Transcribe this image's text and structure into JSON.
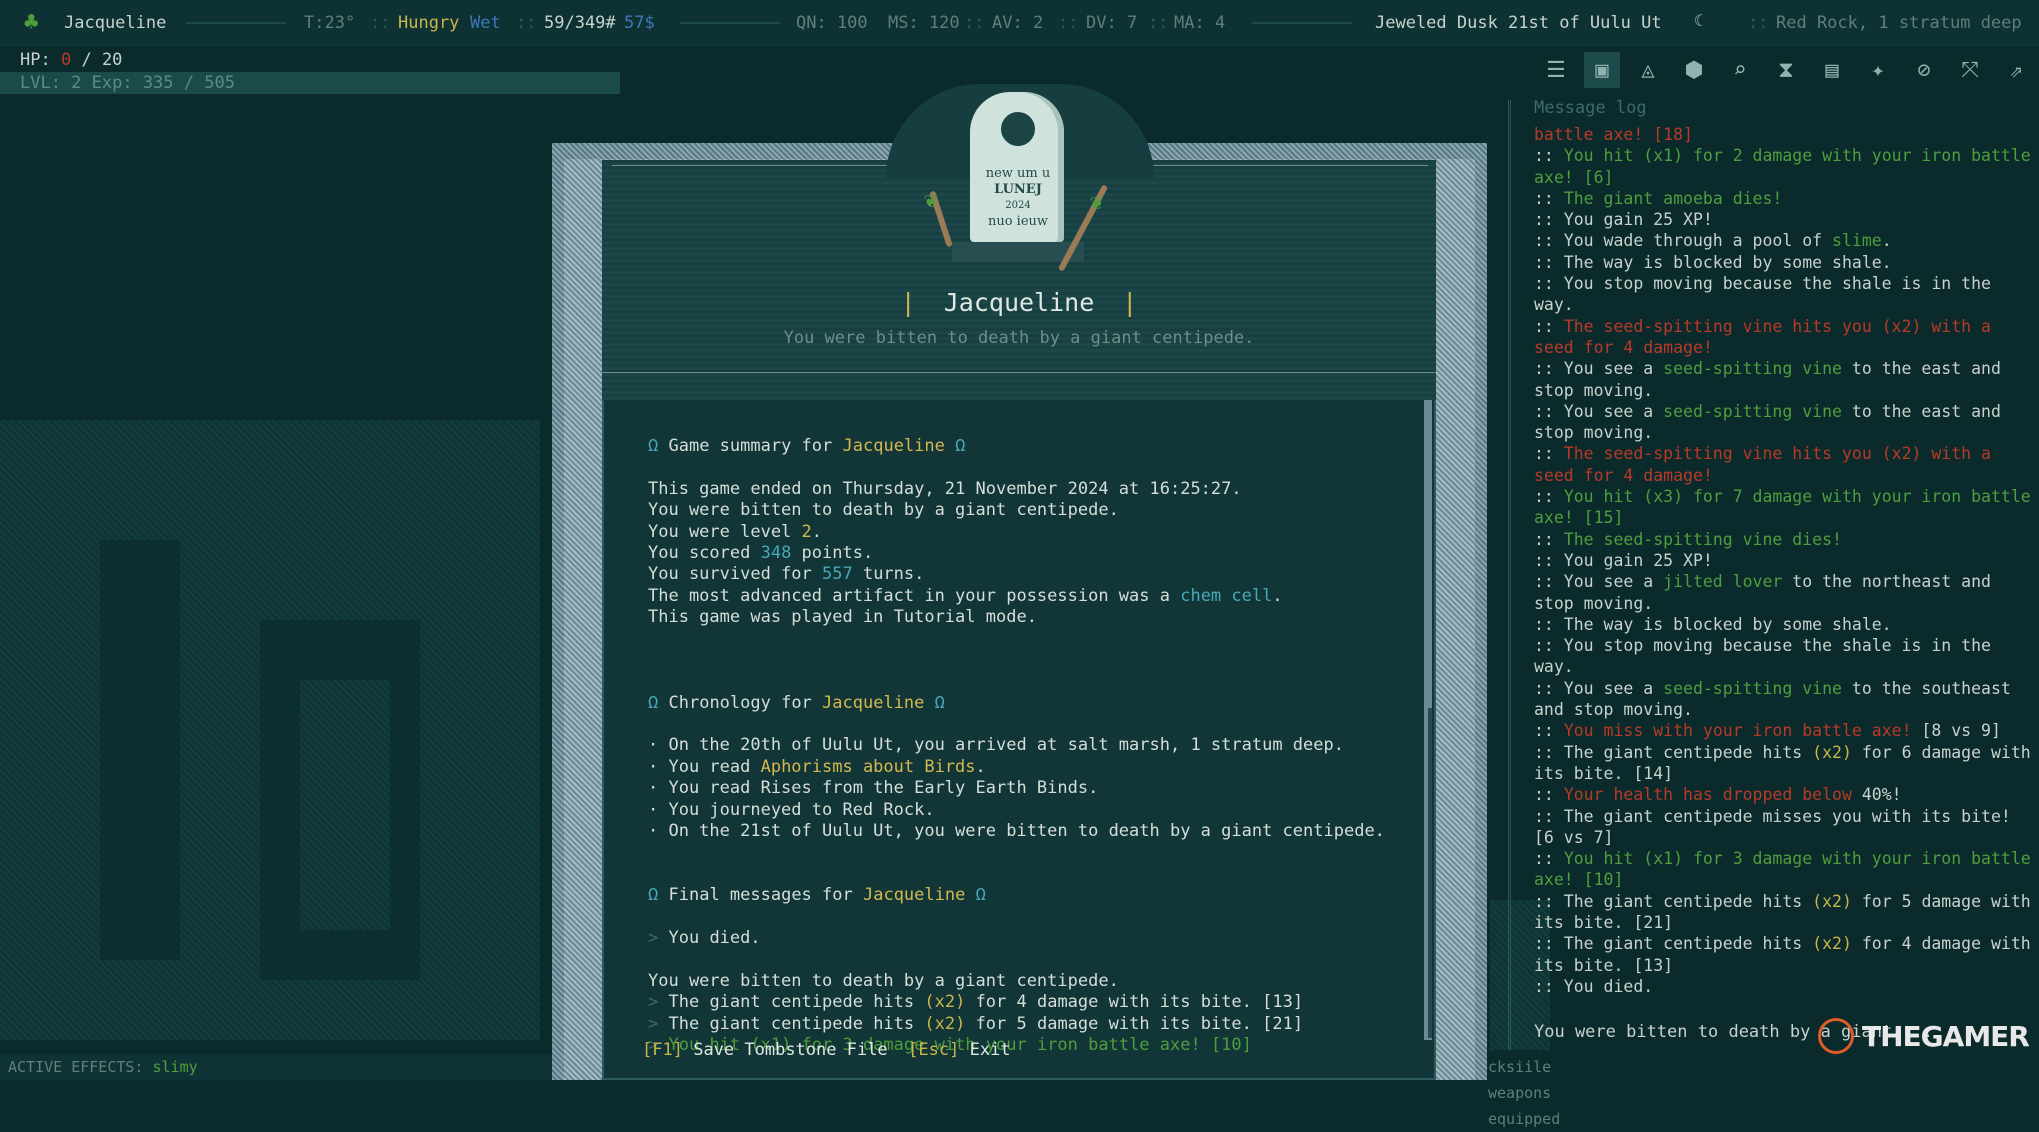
{
  "topbar": {
    "name": "Jacqueline",
    "temp": "T:23°",
    "hunger": "Hungry",
    "wet": "Wet",
    "weight": "59/349#",
    "money": "57$",
    "qn": "QN: 100",
    "ms": "MS: 120",
    "av": "AV: 2",
    "dv": "DV: 7",
    "ma": "MA: 4",
    "date": "Jeweled Dusk 21st of Uulu Ut",
    "location": "Red Rock, 1 stratum deep"
  },
  "hud": {
    "hp_label": "HP:",
    "hp_current": "0",
    "hp_max": "/ 20",
    "level": "LVL: 2 Exp: 335 / 505",
    "effects_label": "ACTIVE EFFECTS:",
    "effects_value": "slimy",
    "effects_tail": "cksiile weapons equipped"
  },
  "colors": {
    "accent_yellow": "#c9b64a",
    "hp_red": "#b83a26",
    "link_cyan": "#47a8b8",
    "good_green": "#4f9e3d",
    "background": "#0b2a2c"
  },
  "toolbar": {
    "icons": [
      "menu-icon",
      "window-icon",
      "character-icon",
      "inventory-icon",
      "search-icon",
      "hourglass-icon",
      "journal-icon",
      "abilities-icon",
      "map-icon",
      "wait-icon",
      "rest-icon"
    ]
  },
  "log": {
    "title": "Message log",
    "last": "You were bitten to death by a giant ...",
    "entries": [
      [
        {
          "t": "battle axe! [18]",
          "c": "red"
        }
      ],
      [
        {
          "t": ":: ",
          "c": ""
        },
        {
          "t": "You hit (x1) for 2 damage with your iron battle axe! [6]",
          "c": "grn"
        }
      ],
      [
        {
          "t": ":: ",
          "c": ""
        },
        {
          "t": "The giant amoeba dies!",
          "c": "grn"
        }
      ],
      [
        {
          "t": ":: You gain 25 XP!",
          "c": ""
        }
      ],
      [
        {
          "t": ":: You wade through a pool of ",
          "c": ""
        },
        {
          "t": "slime",
          "c": "grn"
        },
        {
          "t": ".",
          "c": ""
        }
      ],
      [
        {
          "t": ":: The way is blocked by some shale.",
          "c": ""
        }
      ],
      [
        {
          "t": ":: You stop moving because the shale is in the way.",
          "c": ""
        }
      ],
      [
        {
          "t": ":: ",
          "c": ""
        },
        {
          "t": "The seed-spitting vine hits you (x2) with a seed for 4 damage!",
          "c": "red"
        }
      ],
      [
        {
          "t": ":: You see a ",
          "c": ""
        },
        {
          "t": "seed-spitting vine",
          "c": "grn"
        },
        {
          "t": " to the east and stop moving.",
          "c": ""
        }
      ],
      [
        {
          "t": ":: You see a ",
          "c": ""
        },
        {
          "t": "seed-spitting vine",
          "c": "grn"
        },
        {
          "t": " to the east and stop moving.",
          "c": ""
        }
      ],
      [
        {
          "t": ":: ",
          "c": ""
        },
        {
          "t": "The seed-spitting vine hits you (x2) with a seed for 4 damage!",
          "c": "red"
        }
      ],
      [
        {
          "t": ":: ",
          "c": ""
        },
        {
          "t": "You hit (x3) for 7 damage with your iron battle axe! [15]",
          "c": "grn"
        }
      ],
      [
        {
          "t": ":: ",
          "c": ""
        },
        {
          "t": "The seed-spitting vine dies!",
          "c": "grn"
        }
      ],
      [
        {
          "t": ":: You gain 25 XP!",
          "c": ""
        }
      ],
      [
        {
          "t": ":: You see a ",
          "c": ""
        },
        {
          "t": "jilted lover",
          "c": "grn"
        },
        {
          "t": " to the northeast and stop moving.",
          "c": ""
        }
      ],
      [
        {
          "t": ":: The way is blocked by some shale.",
          "c": ""
        }
      ],
      [
        {
          "t": ":: You stop moving because the shale is in the way.",
          "c": ""
        }
      ],
      [
        {
          "t": ":: You see a ",
          "c": ""
        },
        {
          "t": "seed-spitting vine",
          "c": "grn"
        },
        {
          "t": " to the southeast and stop moving.",
          "c": ""
        }
      ],
      [
        {
          "t": ":: ",
          "c": ""
        },
        {
          "t": "You miss with your iron battle axe!",
          "c": "red"
        },
        {
          "t": " [8 vs 9]",
          "c": ""
        }
      ],
      [
        {
          "t": ":: The giant centipede hits ",
          "c": ""
        },
        {
          "t": "(x2)",
          "c": "yel"
        },
        {
          "t": " for 6 damage with its bite. [14]",
          "c": ""
        }
      ],
      [
        {
          "t": ":: ",
          "c": ""
        },
        {
          "t": "Your health has dropped below",
          "c": "red"
        },
        {
          "t": " 40%!",
          "c": ""
        }
      ],
      [
        {
          "t": ":: The giant centipede misses you with its bite! [6 vs 7]",
          "c": ""
        }
      ],
      [
        {
          "t": ":: ",
          "c": ""
        },
        {
          "t": "You hit (x1) for 3 damage with your iron battle axe! [10]",
          "c": "grn"
        }
      ],
      [
        {
          "t": ":: The giant centipede hits ",
          "c": ""
        },
        {
          "t": "(x2)",
          "c": "yel"
        },
        {
          "t": " for 5 damage with its bite. [21]",
          "c": ""
        }
      ],
      [
        {
          "t": ":: The giant centipede hits ",
          "c": ""
        },
        {
          "t": "(x2)",
          "c": "yel"
        },
        {
          "t": " for 4 damage with its bite. [13]",
          "c": ""
        }
      ],
      [
        {
          "t": ":: You died.",
          "c": ""
        }
      ]
    ]
  },
  "tombstone": {
    "stone_text": [
      "new um u",
      "LUNEJ",
      "2024",
      "nuo ieuw"
    ],
    "name": "Jacqueline",
    "subtitle": "You were bitten to death by a giant centipede."
  },
  "summary": {
    "omega": "Ω",
    "summary_heading": "Game summary for",
    "player": "Jacqueline",
    "lines": {
      "ended": "This game ended on Thursday, 21 November 2024 at 16:25:27.",
      "bitten": "You were bitten to death by a giant centipede.",
      "level_pre": "You were level ",
      "level_val": "2",
      "level_post": ".",
      "scored_pre": "You scored ",
      "scored_val": "348",
      "scored_post": " points.",
      "survived_pre": "You survived for ",
      "survived_val": "557",
      "survived_post": " turns.",
      "artifact_pre": "The most advanced artifact in your possession was a ",
      "artifact_val": "chem cell",
      "artifact_post": ".",
      "mode": "This game was played in Tutorial mode."
    },
    "chronology_heading": "Chronology for",
    "chronology": {
      "c1": "· On the 20th of Uulu Ut, you arrived at salt marsh, 1 stratum deep.",
      "c2_pre": "· You read ",
      "c2_val": "Aphorisms about Birds",
      "c2_post": ".",
      "c3": "· You read Rises from the Early Earth Binds.",
      "c4": "· You journeyed to Red Rock.",
      "c5": "· On the 21st of Uulu Ut, you were bitten to death by a giant centipede."
    },
    "final_heading": "Final messages for",
    "final": {
      "chev": ">",
      "died": "You died.",
      "bitten": "You were bitten to death by a giant centipede.",
      "f1_pre": "The giant centipede hits ",
      "f1_x": "(x2)",
      "f1_post": " for 4 damage with its bite. [13]",
      "f2_pre": "The giant centipede hits ",
      "f2_x": "(x2)",
      "f2_post": " for 5 damage with its bite. [21]",
      "f3": "You hit (x1) for 3 damage with your iron battle axe! [10]"
    }
  },
  "footer": {
    "save_key": "[F1]",
    "save_label": "Save Tombstone File",
    "exit_key": "[Esc]",
    "exit_label": "Exit"
  },
  "watermark": {
    "text": "THEGAMER"
  }
}
